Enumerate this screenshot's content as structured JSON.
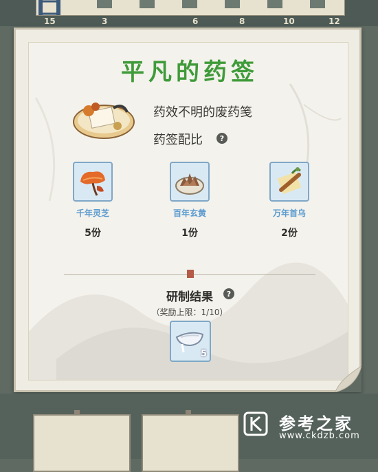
{
  "top_ruler": {
    "ticks": [
      "15",
      "3",
      "6",
      "8",
      "10",
      "12"
    ]
  },
  "recipe": {
    "title": "平凡的药签",
    "description": "药效不明的废药笺",
    "ratio_label": "药签配比",
    "help_symbol": "?"
  },
  "ingredients": [
    {
      "name": "千年灵芝",
      "qty": "5份",
      "icon": "lingzhi-icon"
    },
    {
      "name": "百年玄黄",
      "qty": "1份",
      "icon": "xuanhuang-icon"
    },
    {
      "name": "万年首乌",
      "qty": "2份",
      "icon": "shouwu-icon"
    }
  ],
  "result": {
    "title": "研制结果",
    "limit": "（奖励上限：1/10）",
    "reward_count": "5",
    "reward_icon": "medicine-dish-icon"
  },
  "watermark": {
    "name": "参考之家",
    "url": "www.ckdzb.com"
  },
  "colors": {
    "title_green": "#3f9b3a",
    "ingredient_blue": "#5a9bd0",
    "panel": "#efece3"
  }
}
